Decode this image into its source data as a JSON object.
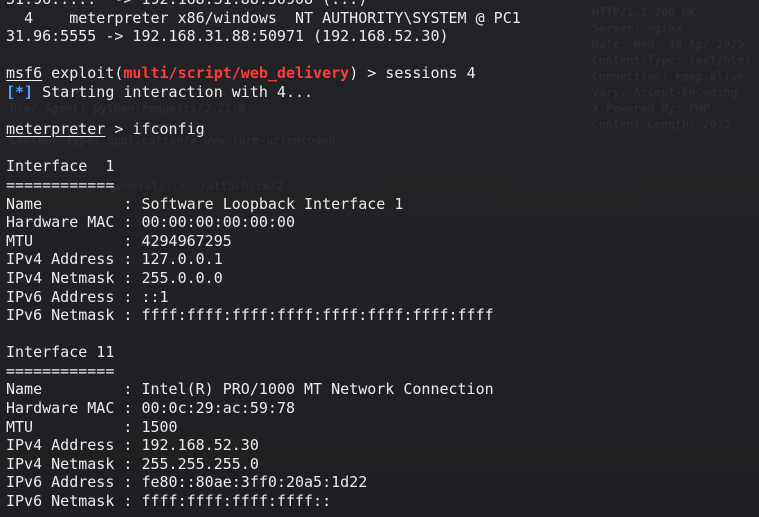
{
  "background_text": {
    "right": [
      "HTTP/1.1 200 OK",
      "Server: nginx",
      "Date: Wed, 30 Apr 2025",
      "Content-Type: text/html",
      "Connection: keep-alive",
      "Vary: Accept-Encoding",
      "X-Powered-By: PHP",
      "Content-Length: 2632"
    ],
    "left": [
      "User-Agent: python-requests/2.21.0",
      "",
      "Content-Type: application/x-www-form-urlencoded"
    ],
    "middle": [
      "general/../../attach/im/2"
    ]
  },
  "terminal": {
    "line0": "31.96.....  -> 192.168.31.88:50908 (...)",
    "session_row": {
      "id": "4",
      "type": "meterpreter x86/windows",
      "info": "NT AUTHORITY\\SYSTEM @ PC1"
    },
    "connection_line": "31.96:5555 -> 192.168.31.88:50971 (192.168.52.30)",
    "prompt1": {
      "msf": "msf6",
      "word": " exploit(",
      "module": "multi/script/web_delivery",
      "rest": ") > sessions 4"
    },
    "status": {
      "marker": "[*]",
      "text": " Starting interaction with 4..."
    },
    "prompt2": {
      "name": "meterpreter",
      "rest": " > ifconfig"
    },
    "interfaces": [
      {
        "header": "Interface  1",
        "separator": "============",
        "rows": [
          {
            "label": "Name",
            "value": "Software Loopback Interface 1"
          },
          {
            "label": "Hardware MAC",
            "value": "00:00:00:00:00:00"
          },
          {
            "label": "MTU",
            "value": "4294967295"
          },
          {
            "label": "IPv4 Address",
            "value": "127.0.0.1"
          },
          {
            "label": "IPv4 Netmask",
            "value": "255.0.0.0"
          },
          {
            "label": "IPv6 Address",
            "value": "::1"
          },
          {
            "label": "IPv6 Netmask",
            "value": "ffff:ffff:ffff:ffff:ffff:ffff:ffff:ffff"
          }
        ]
      },
      {
        "header": "Interface 11",
        "separator": "============",
        "rows": [
          {
            "label": "Name",
            "value": "Intel(R) PRO/1000 MT Network Connection"
          },
          {
            "label": "Hardware MAC",
            "value": "00:0c:29:ac:59:78"
          },
          {
            "label": "MTU",
            "value": "1500"
          },
          {
            "label": "IPv4 Address",
            "value": "192.168.52.30"
          },
          {
            "label": "IPv4 Netmask",
            "value": "255.255.255.0"
          },
          {
            "label": "IPv6 Address",
            "value": "fe80::80ae:3ff0:20a5:1d22"
          },
          {
            "label": "IPv6 Netmask",
            "value": "ffff:ffff:ffff:ffff::"
          }
        ]
      }
    ]
  },
  "colors": {
    "text": "#ececec",
    "module": "#ff3b3b",
    "status_marker": "#4aa3ff",
    "background": "#1f2023"
  }
}
